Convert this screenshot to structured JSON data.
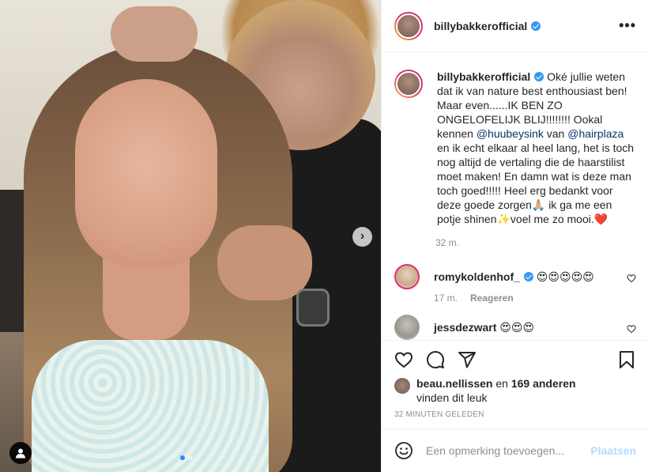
{
  "post": {
    "username": "billybakkerofficial",
    "more_label": "•••"
  },
  "caption": {
    "username": "billybakkerofficial",
    "text_1": " Oké jullie weten dat ik van nature best enthousiast ben! Maar even......IK BEN ZO ONGELOFELIJK BLIJ!!!!!!!! Ookal kennen ",
    "mention_1": "@huubeysink",
    "text_2": " van ",
    "mention_2": "@hairplaza",
    "text_3": " en ik echt elkaar al heel lang, het is toch nog altijd de vertaling die de haarstilist moet maken! En damn wat is deze man toch goed!!!!! Heel erg bedankt voor deze goede zorgen🙏🏼 ik ga me een potje shinen✨voel me zo mooi.❤️",
    "time": "32 m."
  },
  "comments": [
    {
      "username": "romykoldenhof_",
      "verified": true,
      "text": "😍😍😍😍😍",
      "time": "17 m.",
      "reply_label": "Reageren"
    },
    {
      "username": "jessdezwart",
      "verified": false,
      "text": "😍😍😍",
      "time": "",
      "reply_label": ""
    }
  ],
  "likes": {
    "liker": "beau.nellissen",
    "connector": " en ",
    "others": "169 anderen",
    "suffix": "vinden dit leuk"
  },
  "posted_time": "32 MINUTEN GELEDEN",
  "add_comment": {
    "placeholder": "Een opmerking toevoegen...",
    "post_label": "Plaatsen"
  },
  "carousel": {
    "next_label": "›",
    "current_slide": 1,
    "total_slides": 2
  },
  "colors": {
    "verified": "#3897f0",
    "mention": "#00376b",
    "meta": "#8e8e8e",
    "post_button": "#b3dbff"
  },
  "icons": [
    "more-icon",
    "heart-icon",
    "comment-icon",
    "share-icon",
    "bookmark-icon",
    "smiley-icon",
    "tag-user-icon",
    "chevron-right-icon",
    "verified-icon"
  ]
}
